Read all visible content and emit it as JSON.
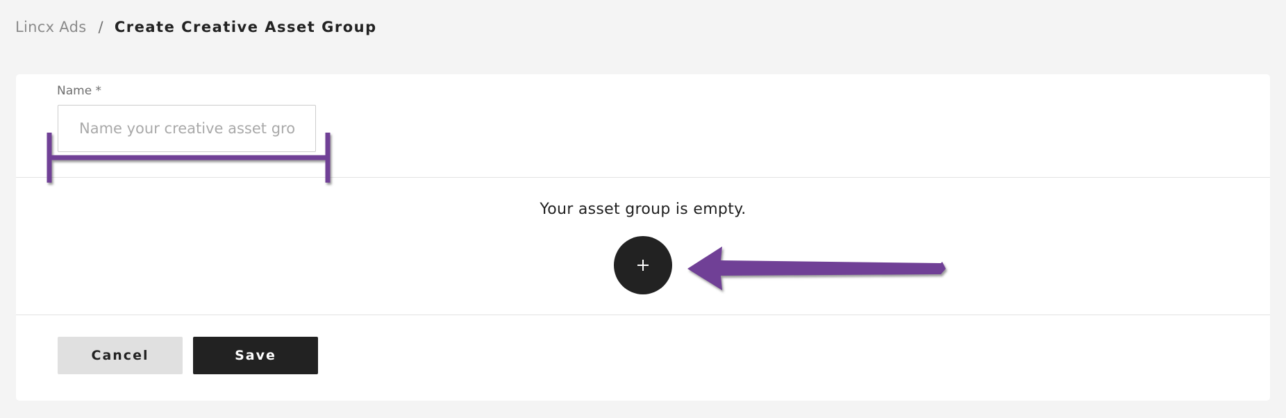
{
  "breadcrumb": {
    "root": "Lincx Ads",
    "separator": "/",
    "current": "Create Creative Asset Group"
  },
  "form": {
    "name_label": "Name *",
    "name_placeholder": "Name your creative asset grou",
    "name_value": ""
  },
  "assets": {
    "empty_message": "Your asset group is empty.",
    "add_icon": "plus-icon"
  },
  "actions": {
    "cancel_label": "Cancel",
    "save_label": "Save"
  },
  "annotations": {
    "color": "#6f3f96",
    "shadow_color": "#555555"
  }
}
